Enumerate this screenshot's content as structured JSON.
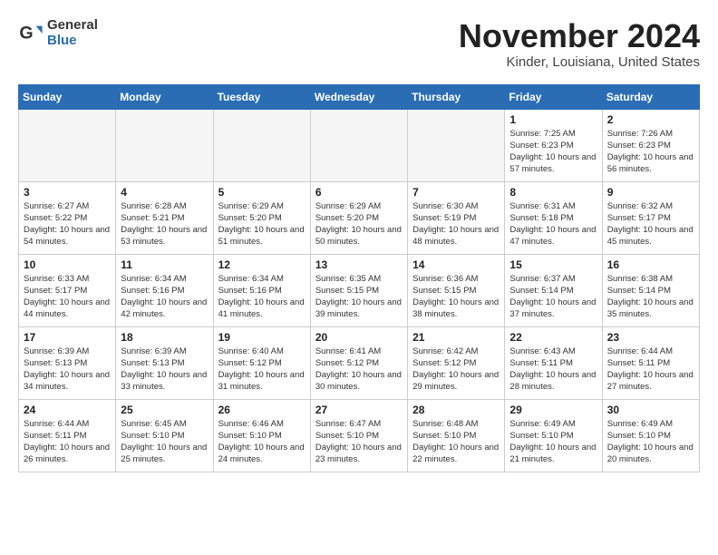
{
  "header": {
    "logo_general": "General",
    "logo_blue": "Blue",
    "month_title": "November 2024",
    "location": "Kinder, Louisiana, United States"
  },
  "weekdays": [
    "Sunday",
    "Monday",
    "Tuesday",
    "Wednesday",
    "Thursday",
    "Friday",
    "Saturday"
  ],
  "weeks": [
    [
      {
        "day": "",
        "empty": true
      },
      {
        "day": "",
        "empty": true
      },
      {
        "day": "",
        "empty": true
      },
      {
        "day": "",
        "empty": true
      },
      {
        "day": "",
        "empty": true
      },
      {
        "day": "1",
        "sunrise": "7:25 AM",
        "sunset": "6:23 PM",
        "daylight": "10 hours and 57 minutes."
      },
      {
        "day": "2",
        "sunrise": "7:26 AM",
        "sunset": "6:23 PM",
        "daylight": "10 hours and 56 minutes."
      }
    ],
    [
      {
        "day": "3",
        "sunrise": "6:27 AM",
        "sunset": "5:22 PM",
        "daylight": "10 hours and 54 minutes."
      },
      {
        "day": "4",
        "sunrise": "6:28 AM",
        "sunset": "5:21 PM",
        "daylight": "10 hours and 53 minutes."
      },
      {
        "day": "5",
        "sunrise": "6:29 AM",
        "sunset": "5:20 PM",
        "daylight": "10 hours and 51 minutes."
      },
      {
        "day": "6",
        "sunrise": "6:29 AM",
        "sunset": "5:20 PM",
        "daylight": "10 hours and 50 minutes."
      },
      {
        "day": "7",
        "sunrise": "6:30 AM",
        "sunset": "5:19 PM",
        "daylight": "10 hours and 48 minutes."
      },
      {
        "day": "8",
        "sunrise": "6:31 AM",
        "sunset": "5:18 PM",
        "daylight": "10 hours and 47 minutes."
      },
      {
        "day": "9",
        "sunrise": "6:32 AM",
        "sunset": "5:17 PM",
        "daylight": "10 hours and 45 minutes."
      }
    ],
    [
      {
        "day": "10",
        "sunrise": "6:33 AM",
        "sunset": "5:17 PM",
        "daylight": "10 hours and 44 minutes."
      },
      {
        "day": "11",
        "sunrise": "6:34 AM",
        "sunset": "5:16 PM",
        "daylight": "10 hours and 42 minutes."
      },
      {
        "day": "12",
        "sunrise": "6:34 AM",
        "sunset": "5:16 PM",
        "daylight": "10 hours and 41 minutes."
      },
      {
        "day": "13",
        "sunrise": "6:35 AM",
        "sunset": "5:15 PM",
        "daylight": "10 hours and 39 minutes."
      },
      {
        "day": "14",
        "sunrise": "6:36 AM",
        "sunset": "5:15 PM",
        "daylight": "10 hours and 38 minutes."
      },
      {
        "day": "15",
        "sunrise": "6:37 AM",
        "sunset": "5:14 PM",
        "daylight": "10 hours and 37 minutes."
      },
      {
        "day": "16",
        "sunrise": "6:38 AM",
        "sunset": "5:14 PM",
        "daylight": "10 hours and 35 minutes."
      }
    ],
    [
      {
        "day": "17",
        "sunrise": "6:39 AM",
        "sunset": "5:13 PM",
        "daylight": "10 hours and 34 minutes."
      },
      {
        "day": "18",
        "sunrise": "6:39 AM",
        "sunset": "5:13 PM",
        "daylight": "10 hours and 33 minutes."
      },
      {
        "day": "19",
        "sunrise": "6:40 AM",
        "sunset": "5:12 PM",
        "daylight": "10 hours and 31 minutes."
      },
      {
        "day": "20",
        "sunrise": "6:41 AM",
        "sunset": "5:12 PM",
        "daylight": "10 hours and 30 minutes."
      },
      {
        "day": "21",
        "sunrise": "6:42 AM",
        "sunset": "5:12 PM",
        "daylight": "10 hours and 29 minutes."
      },
      {
        "day": "22",
        "sunrise": "6:43 AM",
        "sunset": "5:11 PM",
        "daylight": "10 hours and 28 minutes."
      },
      {
        "day": "23",
        "sunrise": "6:44 AM",
        "sunset": "5:11 PM",
        "daylight": "10 hours and 27 minutes."
      }
    ],
    [
      {
        "day": "24",
        "sunrise": "6:44 AM",
        "sunset": "5:11 PM",
        "daylight": "10 hours and 26 minutes."
      },
      {
        "day": "25",
        "sunrise": "6:45 AM",
        "sunset": "5:10 PM",
        "daylight": "10 hours and 25 minutes."
      },
      {
        "day": "26",
        "sunrise": "6:46 AM",
        "sunset": "5:10 PM",
        "daylight": "10 hours and 24 minutes."
      },
      {
        "day": "27",
        "sunrise": "6:47 AM",
        "sunset": "5:10 PM",
        "daylight": "10 hours and 23 minutes."
      },
      {
        "day": "28",
        "sunrise": "6:48 AM",
        "sunset": "5:10 PM",
        "daylight": "10 hours and 22 minutes."
      },
      {
        "day": "29",
        "sunrise": "6:49 AM",
        "sunset": "5:10 PM",
        "daylight": "10 hours and 21 minutes."
      },
      {
        "day": "30",
        "sunrise": "6:49 AM",
        "sunset": "5:10 PM",
        "daylight": "10 hours and 20 minutes."
      }
    ]
  ]
}
